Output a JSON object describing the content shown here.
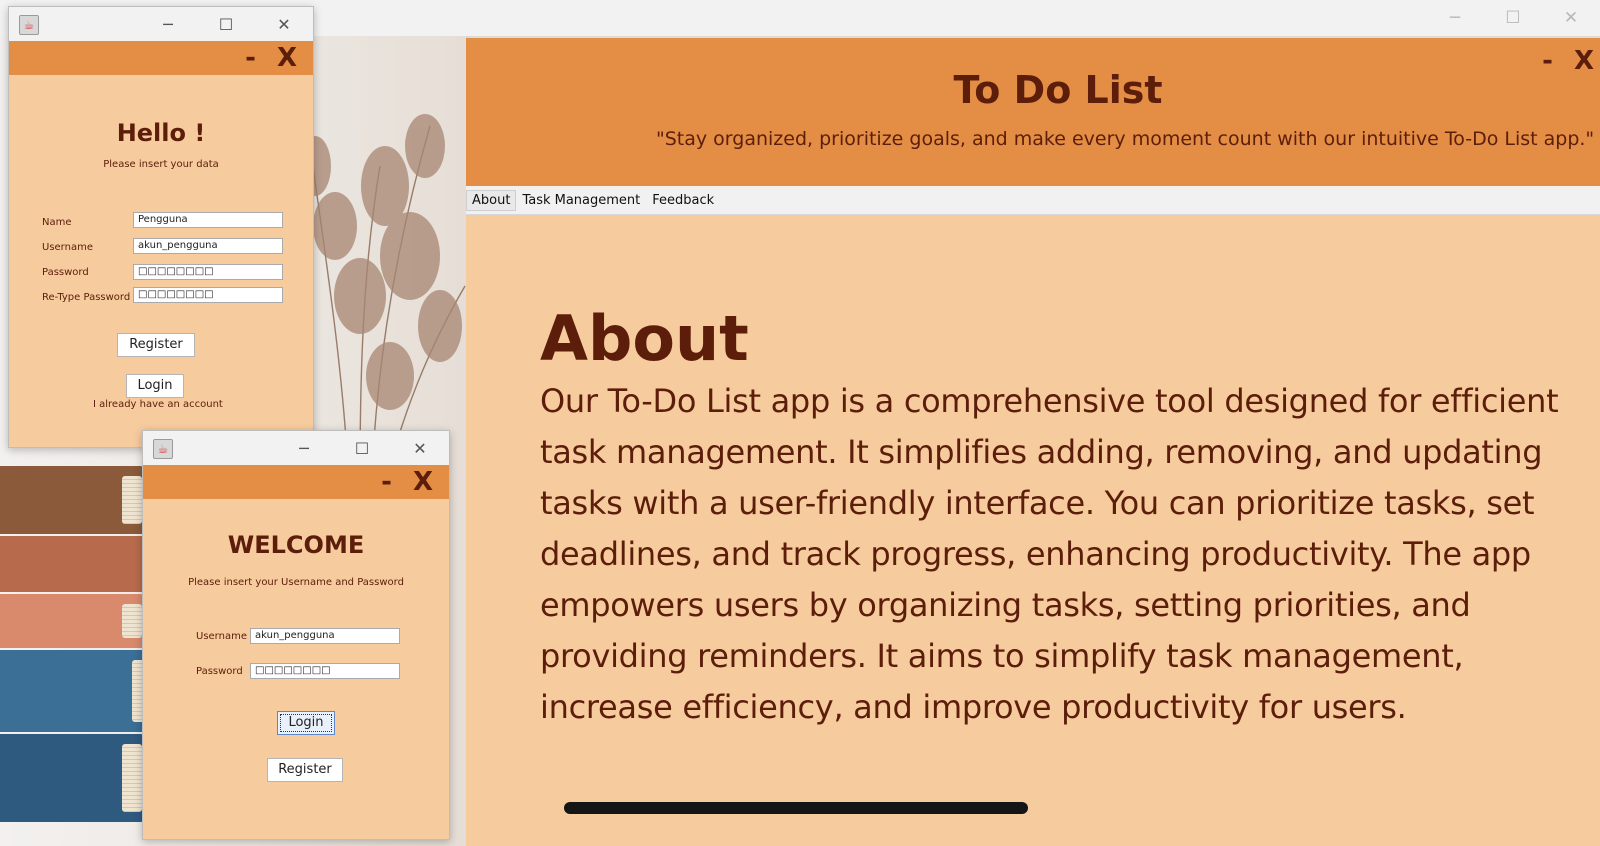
{
  "main_window": {
    "controls": {
      "minimize": "─",
      "maximize": "☐",
      "close": "✕"
    }
  },
  "app": {
    "header_controls": "- X",
    "title": "To Do List",
    "tagline": "\"Stay organized, prioritize goals, and make every moment count with our intuitive To-Do List app.\"",
    "menu": [
      "About",
      "Task Management",
      "Feedback"
    ],
    "active_menu": "About",
    "about_heading": "About",
    "about_text": "Our To-Do List app is a comprehensive tool designed for efficient task management. It simplifies adding, removing, and updating tasks with a user-friendly interface. You can prioritize tasks, set deadlines, and track progress, enhancing productivity. The app empowers users by organizing tasks, setting priorities, and providing reminders. It aims to simplify task management, increase efficiency, and improve productivity for users."
  },
  "register_dialog": {
    "controls": {
      "minimize": "─",
      "maximize": "☐",
      "close": "✕"
    },
    "header_controls": "- X",
    "title": "Hello !",
    "subtitle": "Please insert your data",
    "fields": [
      {
        "label": "Name",
        "value": "Pengguna"
      },
      {
        "label": "Username",
        "value": "akun_pengguna"
      },
      {
        "label": "Password",
        "value": "□□□□□□□□"
      },
      {
        "label": "Re-Type Password",
        "value": "□□□□□□□□"
      }
    ],
    "register_button": "Register",
    "login_button": "Login",
    "login_note": "I already have an account"
  },
  "login_dialog": {
    "controls": {
      "minimize": "─",
      "maximize": "☐",
      "close": "✕"
    },
    "header_controls": "- X",
    "title": "WELCOME",
    "subtitle": "Please insert your Username and Password",
    "fields": [
      {
        "label": "Username",
        "value": "akun_pengguna"
      },
      {
        "label": "Password",
        "value": "□□□□□□□□"
      }
    ],
    "login_button": "Login",
    "register_button": "Register"
  },
  "colors": {
    "orange_header": "#e48d44",
    "peach_background": "#f6cb9e",
    "brown_text": "#5c1e0b"
  }
}
